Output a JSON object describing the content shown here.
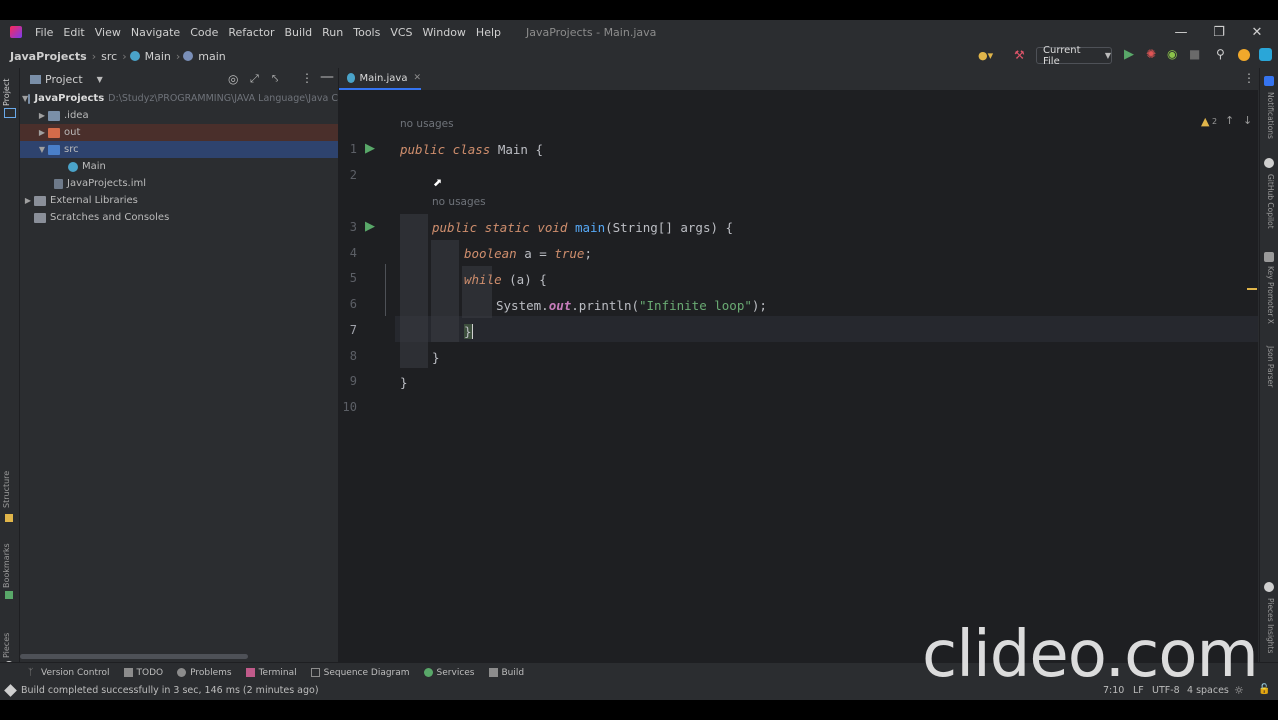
{
  "menu": {
    "items": [
      "File",
      "Edit",
      "View",
      "Navigate",
      "Code",
      "Refactor",
      "Build",
      "Run",
      "Tools",
      "VCS",
      "Window",
      "Help"
    ],
    "window_title": "JavaProjects - Main.java"
  },
  "nav": {
    "crumbs": [
      "JavaProjects",
      "src",
      "Main",
      "main"
    ],
    "run_config": "Current File"
  },
  "project": {
    "panel_title": "Project",
    "tree": [
      {
        "label": "JavaProjects",
        "path": "D:\\Studyz\\PROGRAMMING\\JAVA Language\\Java C"
      },
      {
        "label": ".idea"
      },
      {
        "label": "out"
      },
      {
        "label": "src"
      },
      {
        "label": "Main"
      },
      {
        "label": "JavaProjects.iml"
      },
      {
        "label": "External Libraries"
      },
      {
        "label": "Scratches and Consoles"
      }
    ]
  },
  "left_stripe": {
    "project": "Project",
    "structure": "Structure",
    "bookmarks": "Bookmarks",
    "pieces": "Pieces"
  },
  "editor": {
    "tab_label": "Main.java",
    "warnings": "2",
    "hint1": "no usages",
    "hint2": "no usages",
    "line_numbers": [
      "1",
      "2",
      "3",
      "4",
      "5",
      "6",
      "7",
      "8",
      "9",
      "10"
    ],
    "code": {
      "l1_kw": "public class ",
      "l1_name": "Main {",
      "l3_kw": "public static void ",
      "l3_fn": "main",
      "l3_rest": "(String[] args) {",
      "l4_kw": "boolean ",
      "l4_mid": "a = ",
      "l4_val": "true",
      "l4_end": ";",
      "l5_kw": "while ",
      "l5_rest": "(a) {",
      "l6_a": "System.",
      "l6_b": "out",
      "l6_c": ".println(",
      "l6_d": "\"Infinite loop\"",
      "l6_e": ");",
      "l7": "}",
      "l8": "}",
      "l9": "}"
    }
  },
  "right_stripe": {
    "a": "Notifications",
    "b": "GitHub Copilot",
    "c": "Key Promoter X",
    "d": "Json Parser",
    "e": "Pieces Insights"
  },
  "bottom_tools": [
    "Version Control",
    "TODO",
    "Problems",
    "Terminal",
    "Sequence Diagram",
    "Services",
    "Build"
  ],
  "status": {
    "message": "Build completed successfully in 3 sec, 146 ms (2 minutes ago)",
    "position": "7:10",
    "line_sep": "LF",
    "encoding": "UTF-8",
    "indent": "4 spaces"
  },
  "watermark": "clideo.com"
}
